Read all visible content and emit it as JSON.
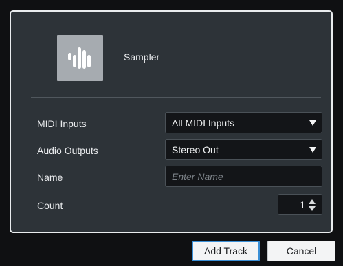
{
  "dialog": {
    "track_type": "Sampler",
    "icon": "sampler-waveform-icon",
    "accent_color": "#3a8fd6",
    "rows": {
      "midi_inputs": {
        "label": "MIDI Inputs",
        "value": "All MIDI Inputs"
      },
      "audio_outputs": {
        "label": "Audio Outputs",
        "value": "Stereo Out"
      },
      "name": {
        "label": "Name",
        "value": "",
        "placeholder": "Enter Name"
      },
      "count": {
        "label": "Count",
        "value": "1"
      }
    },
    "buttons": {
      "add_track": "Add Track",
      "cancel": "Cancel"
    }
  }
}
